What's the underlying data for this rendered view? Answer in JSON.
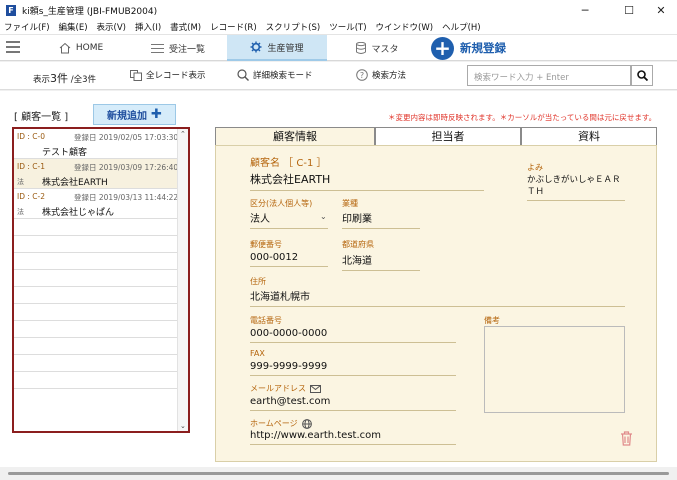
{
  "window": {
    "title": "ki頼s_生産管理 (JBI-FMUB2004)",
    "minimize": "─",
    "maximize": "☐",
    "close": "✕"
  },
  "menu": [
    "ファイル(F)",
    "編集(E)",
    "表示(V)",
    "挿入(I)",
    "書式(M)",
    "レコード(R)",
    "スクリプト(S)",
    "ツール(T)",
    "ウインドウ(W)",
    "ヘルプ(H)"
  ],
  "nav": {
    "home": "HOME",
    "orders": "受注一覧",
    "production": "生産管理",
    "master": "マスタ",
    "new_register": "新規登録"
  },
  "toolbar": {
    "count_prefix": "表示",
    "count_shown": "3件",
    "count_total": "/全3件",
    "all_records": "全レコード表示",
    "detail_search": "詳細検索モード",
    "search_help": "検索方法",
    "search_placeholder": "検索ワード入力 + Enter"
  },
  "list": {
    "header": "[ 顧客一覧 ]",
    "add_button": "新規追加",
    "notice": "＊変更内容は即時反映されます。＊カーソルが当たっている間は元に戻せます。",
    "records": [
      {
        "id": "ID : C-0",
        "date": "登録日 2019/02/05 17:03:30",
        "type": "",
        "name": "テスト顧客"
      },
      {
        "id": "ID : C-1",
        "date": "登録日 2019/03/09 17:26:40",
        "type": "法",
        "name": "株式会社EARTH"
      },
      {
        "id": "ID : C-2",
        "date": "登録日 2019/03/13 11:44:22",
        "type": "法",
        "name": "株式会社じゃぱん"
      }
    ]
  },
  "tabs": {
    "customer": "顧客情報",
    "staff": "担当者",
    "materials": "資料"
  },
  "detail": {
    "name_label": "顧客名 ［ C-1 ］",
    "name": "株式会社EARTH",
    "yomi_label": "よみ",
    "yomi": "かぶしきがいしゃＥＡＲＴＨ",
    "kind_label": "区分(法人個人等)",
    "kind": "法人",
    "industry_label": "業種",
    "industry": "印刷業",
    "zip_label": "郵便番号",
    "zip": "000-0012",
    "pref_label": "都道府県",
    "pref": "北海道",
    "address_label": "住所",
    "address": "北海道札幌市",
    "phone_label": "電話番号",
    "phone": "000-0000-0000",
    "memo_label": "備考",
    "fax_label": "FAX",
    "fax": "999-9999-9999",
    "email_label": "メールアドレス",
    "email": "earth@test.com",
    "web_label": "ホームページ",
    "web": "http://www.earth.test.com"
  },
  "colors": {
    "accent_blue": "#1f5fae",
    "label_orange": "#b5650d",
    "list_border": "#8b1e1e",
    "notice_red": "#e0342a",
    "detail_bg": "#fbf5e2"
  }
}
